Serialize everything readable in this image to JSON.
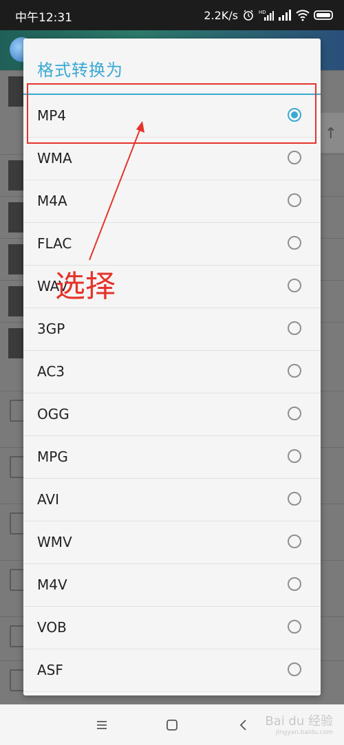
{
  "status_bar": {
    "time": "中午12:31",
    "network_speed": "2.2K/s",
    "icons": [
      "alarm-icon",
      "hd-signal-icon",
      "signal-icon",
      "wifi-icon",
      "battery-icon"
    ]
  },
  "dialog": {
    "title": "格式转换为",
    "options": [
      {
        "label": "MP4",
        "selected": true
      },
      {
        "label": "WMA",
        "selected": false
      },
      {
        "label": "M4A",
        "selected": false
      },
      {
        "label": "FLAC",
        "selected": false
      },
      {
        "label": "WAV",
        "selected": false
      },
      {
        "label": "3GP",
        "selected": false
      },
      {
        "label": "AC3",
        "selected": false
      },
      {
        "label": "OGG",
        "selected": false
      },
      {
        "label": "MPG",
        "selected": false
      },
      {
        "label": "AVI",
        "selected": false
      },
      {
        "label": "WMV",
        "selected": false
      },
      {
        "label": "M4V",
        "selected": false
      },
      {
        "label": "VOB",
        "selected": false
      },
      {
        "label": "ASF",
        "selected": false
      }
    ]
  },
  "annotation": {
    "text": "选择",
    "color": "#e5332a"
  },
  "nav_bar": {
    "icons": [
      "menu-icon",
      "home-icon",
      "back-icon"
    ],
    "watermark": "Bai du 经验",
    "watermark_sub": "jingyan.baidu.com"
  },
  "colors": {
    "accent": "#3aa9d3",
    "annotation": "#e5332a"
  }
}
